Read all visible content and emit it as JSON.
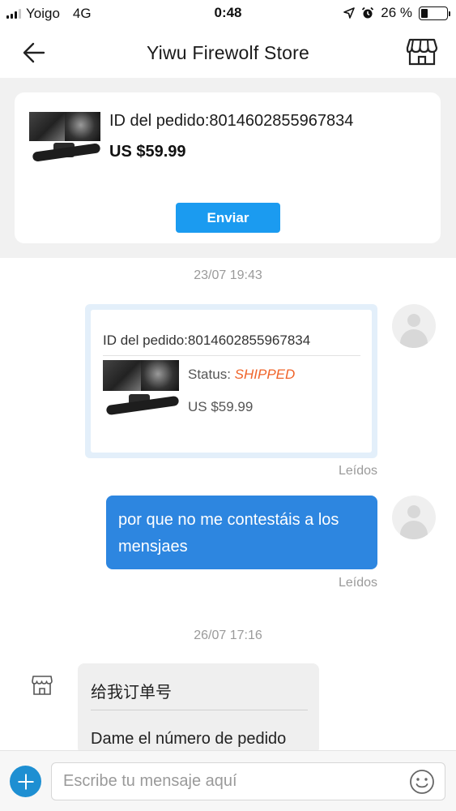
{
  "status_bar": {
    "carrier": "Yoigo",
    "network": "4G",
    "time": "0:48",
    "battery_percent": "26 %",
    "battery_level": 0.26,
    "icons": [
      "signal-icon",
      "location-arrow-icon",
      "alarm-icon",
      "battery-icon"
    ]
  },
  "header": {
    "title": "Yiwu Firewolf Store",
    "back_icon": "back-arrow-icon",
    "store_icon": "store-icon"
  },
  "order_card": {
    "order_id": "ID del pedido:8014602855967834",
    "price": "US $59.99",
    "send_label": "Enviar"
  },
  "chat": {
    "timestamp_1": "23/07 19:43",
    "order_message": {
      "order_id": "ID del pedido:8014602855967834",
      "status_label": "Status: ",
      "status_value": "SHIPPED",
      "price": "US $59.99",
      "read_label": "Leídos"
    },
    "user_message": {
      "text": "por que no me contestáis a los mensjaes",
      "read_label": "Leídos"
    },
    "timestamp_2": "26/07 17:16",
    "store_message": {
      "line_1": "给我订单号",
      "line_2": "Dame el número de pedido"
    }
  },
  "input_bar": {
    "placeholder": "Escribe tu mensaje aquí",
    "plus_icon": "plus-icon",
    "emoji_icon": "emoji-icon"
  },
  "colors": {
    "accent": "#1b9bf0",
    "user_bubble": "#2d86e0",
    "status_shipped": "#f0642a",
    "page_gray": "#f1f1f1"
  }
}
